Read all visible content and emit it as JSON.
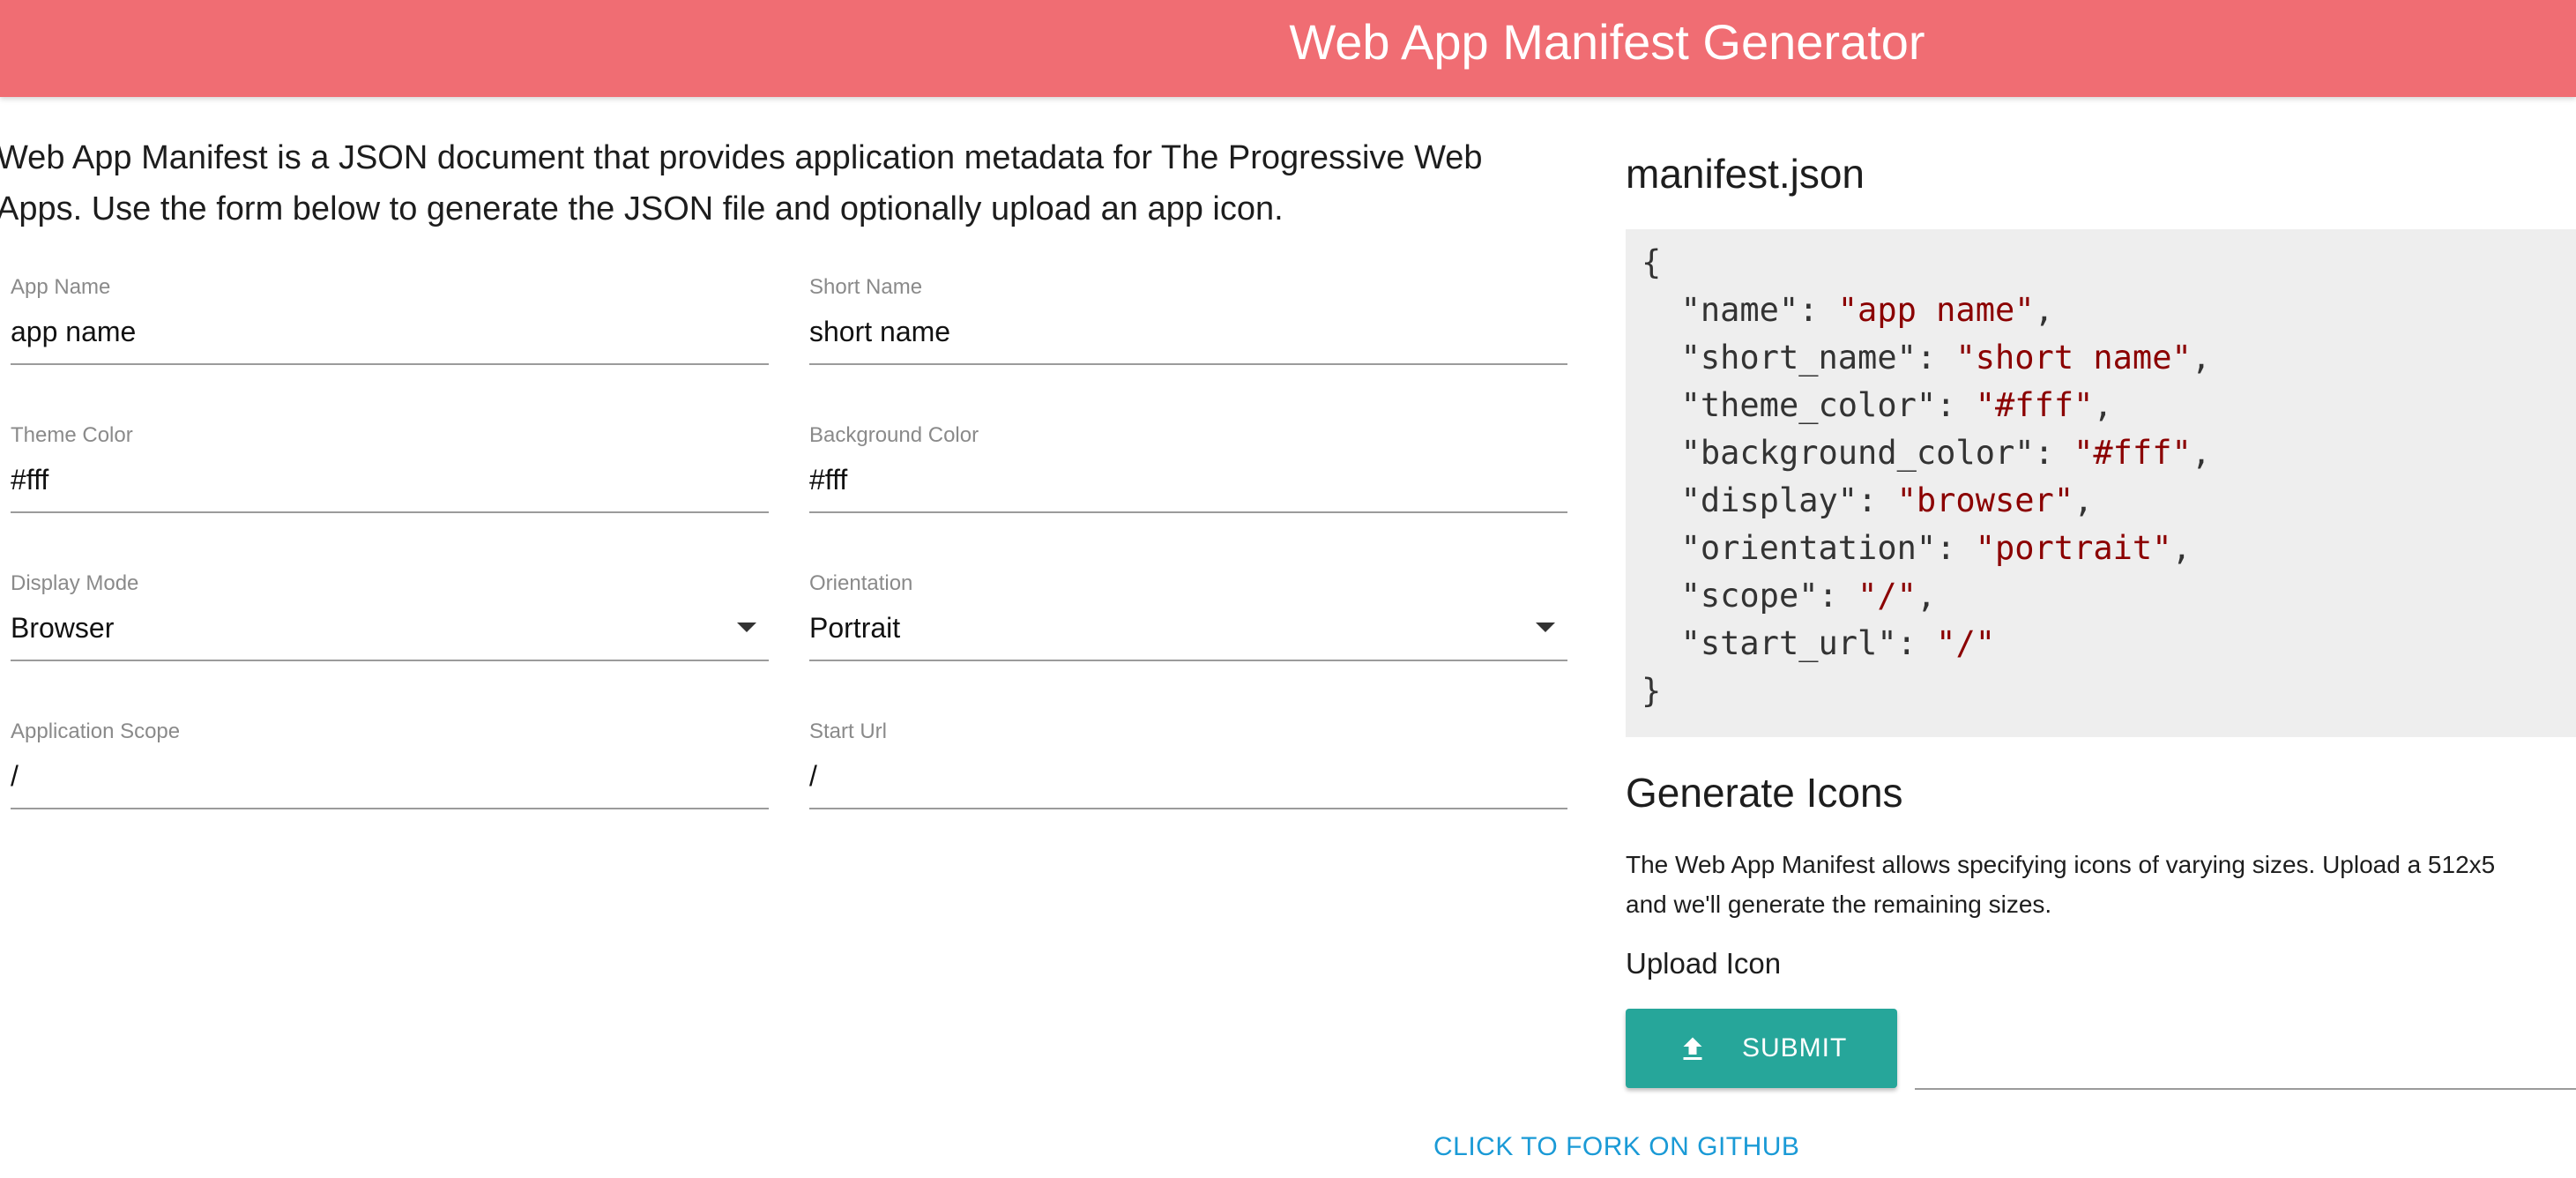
{
  "header": {
    "title": "Web App Manifest Generator",
    "background_color": "#f06d73"
  },
  "intro": {
    "line1": "Web App Manifest is a JSON document that provides application metadata for The Progressive Web",
    "line2": "Apps. Use the form below to generate the JSON file and optionally upload an app icon."
  },
  "form": {
    "app_name": {
      "label": "App Name",
      "value": "app name"
    },
    "short_name": {
      "label": "Short Name",
      "value": "short name"
    },
    "theme_color": {
      "label": "Theme Color",
      "value": "#fff"
    },
    "background_color": {
      "label": "Background Color",
      "value": "#fff"
    },
    "display_mode": {
      "label": "Display Mode",
      "value": "Browser"
    },
    "orientation": {
      "label": "Orientation",
      "value": "Portrait"
    },
    "application_scope": {
      "label": "Application Scope",
      "value": "/"
    },
    "start_url": {
      "label": "Start Url",
      "value": "/"
    }
  },
  "manifest": {
    "heading": "manifest.json",
    "open_brace": "{",
    "close_brace": "}",
    "entries": [
      {
        "key": "\"name\"",
        "value": "\"app name\"",
        "comma": ","
      },
      {
        "key": "\"short_name\"",
        "value": "\"short name\"",
        "comma": ","
      },
      {
        "key": "\"theme_color\"",
        "value": "\"#fff\"",
        "comma": ","
      },
      {
        "key": "\"background_color\"",
        "value": "\"#fff\"",
        "comma": ","
      },
      {
        "key": "\"display\"",
        "value": "\"browser\"",
        "comma": ","
      },
      {
        "key": "\"orientation\"",
        "value": "\"portrait\"",
        "comma": ","
      },
      {
        "key": "\"scope\"",
        "value": "\"/\"",
        "comma": ","
      },
      {
        "key": "\"start_url\"",
        "value": "\"/\"",
        "comma": ""
      }
    ],
    "string_color": "#8b0000",
    "box_color": "#eeeeee"
  },
  "icons": {
    "heading": "Generate Icons",
    "desc_line1": "The Web App Manifest allows specifying icons of varying sizes. Upload a 512x5",
    "desc_line2": "and we'll generate the remaining sizes.",
    "upload_label": "Upload Icon",
    "submit_label": "SUBMIT",
    "submit_icon": "upload-icon",
    "button_color": "#26a69a"
  },
  "footer": {
    "fork_link": "CLICK TO FORK ON GITHUB",
    "link_color": "#1a9ad6"
  }
}
